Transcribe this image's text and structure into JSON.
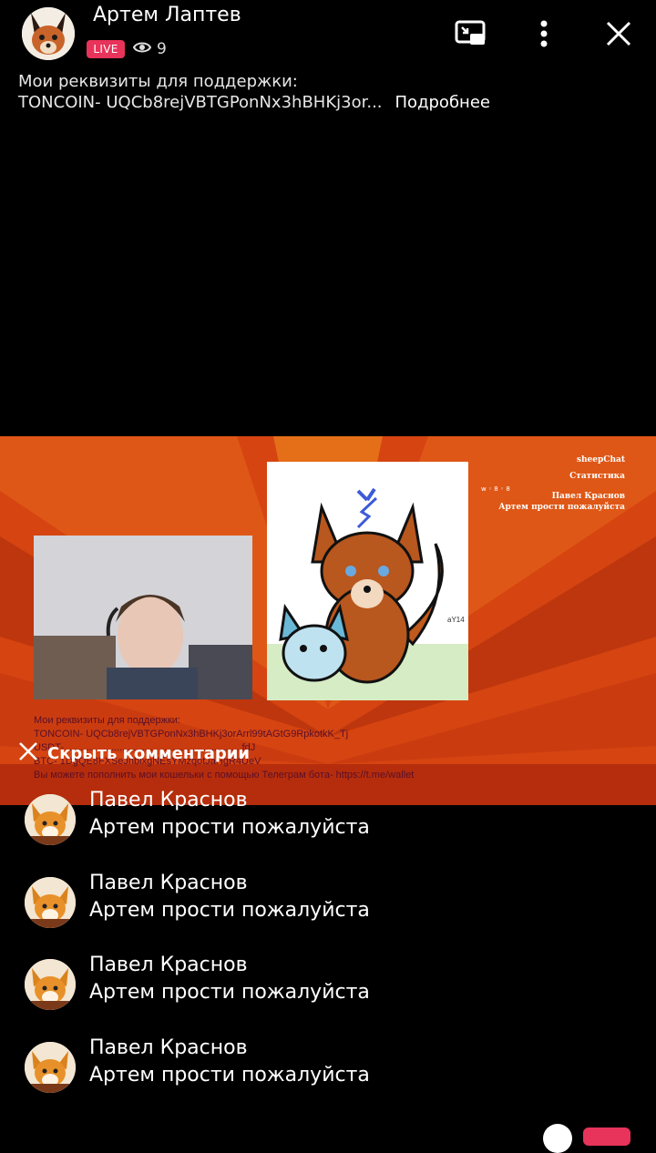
{
  "header": {
    "channel_name": "Артем Лаптев",
    "live_label": "LIVE",
    "viewer_count": "9",
    "icons": [
      "pip-icon",
      "more-vertical-icon",
      "close-icon"
    ]
  },
  "description": {
    "line1": "Мои реквизиты для поддержки:",
    "line2": "TONCOIN- UQCb8rejVBTGPonNx3hBHKj3or...",
    "more_label": "Подробнее"
  },
  "video": {
    "chat_overlay": {
      "title": "sheepChat",
      "stats": "Статистика",
      "user": "Павел Краснов",
      "message": "Артем прости пожалуйста"
    },
    "mini_counter": "w ◦ 8 ◦ 8",
    "drawing_signature": "aY14",
    "overlay_lines": [
      "Мои реквизиты для поддержки:",
      "TONCOIN- UQCb8rejVBTGPonNx3hBHKj3orArrl99tAGtG9RpkotkK_Tj",
      "USDT- ...............................................................fdJ",
      "BTC- 1DgQE8FXSeJnbixgNEsYMzqotJaHgR4UeV",
      "Вы можете пополнить мои кошельки с помощью Телеграм бота- https://t.me/wallet"
    ],
    "colors": {
      "bg": "#d54411",
      "stripe_dark": "#b8330d",
      "stripe_light": "#ee7a1c"
    }
  },
  "hide_comments_label": "Скрыть комментарии",
  "comments": [
    {
      "name": "Павел Краснов",
      "text": "Артем прости пожалуйста"
    },
    {
      "name": "Павел Краснов",
      "text": "Артем прости пожалуйста"
    },
    {
      "name": "Павел Краснов",
      "text": "Артем прости пожалуйста"
    },
    {
      "name": "Павел Краснов",
      "text": "Артем прости пожалуйста"
    }
  ],
  "colors": {
    "live": "#e8335a",
    "background": "#000000"
  }
}
